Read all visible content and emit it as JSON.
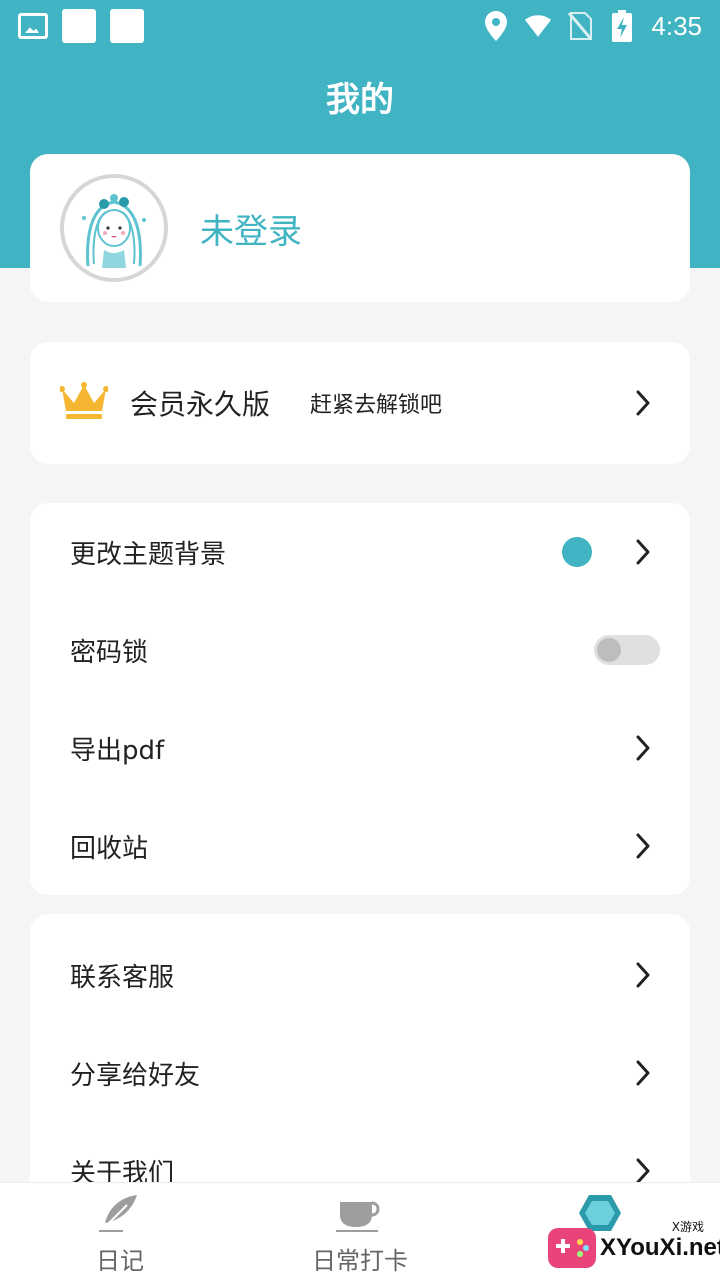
{
  "status_bar": {
    "time": "4:35"
  },
  "header": {
    "title": "我的"
  },
  "profile": {
    "login_text": "未登录"
  },
  "vip": {
    "title": "会员永久版",
    "subtitle": "赶紧去解锁吧"
  },
  "settings": [
    {
      "label": "更改主题背景"
    },
    {
      "label": "密码锁"
    },
    {
      "label": "导出pdf"
    },
    {
      "label": "回收站"
    }
  ],
  "more": [
    {
      "label": "联系客服"
    },
    {
      "label": "分享给好友"
    },
    {
      "label": "关于我们"
    }
  ],
  "bottom_nav": [
    {
      "label": "日记",
      "icon": "feather-icon"
    },
    {
      "label": "日常打卡",
      "icon": "cup-icon"
    },
    {
      "label": "",
      "icon": "hexagon-icon"
    }
  ],
  "watermark": {
    "text": "XYouXi.net",
    "small": "X游戏"
  },
  "colors": {
    "accent": "#40b4c2",
    "crown": "#f5b731"
  },
  "password_lock_enabled": false
}
